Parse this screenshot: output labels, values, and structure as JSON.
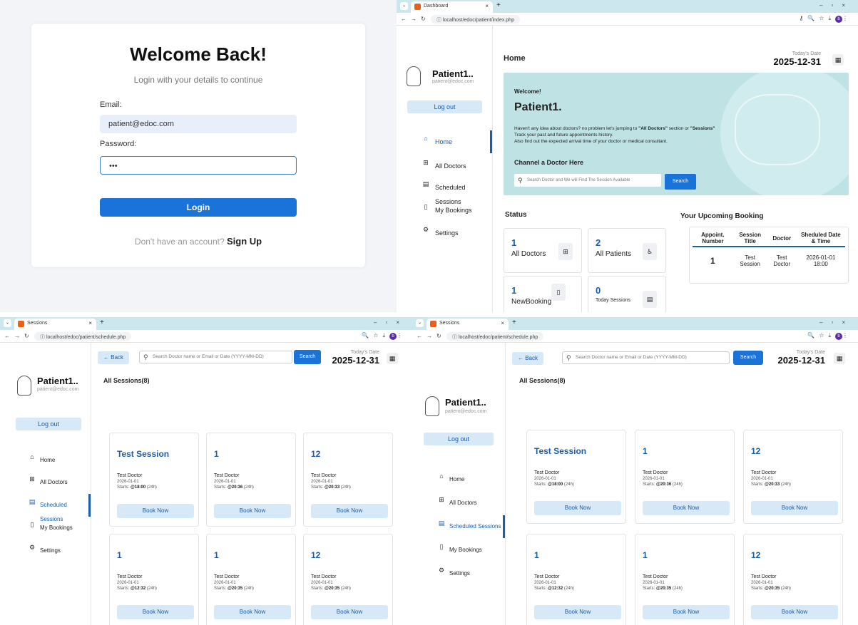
{
  "login": {
    "title": "Welcome Back!",
    "subtitle": "Login with your details to continue",
    "email_label": "Email:",
    "email_value": "patient@edoc.com",
    "password_label": "Password:",
    "password_value": "•••",
    "login_label": "Login",
    "signup_prompt": "Don't have an account?",
    "signup_link": "Sign Up"
  },
  "browser": {
    "dashboard_tab": "Dashboard",
    "sessions_tab": "Sessions",
    "dashboard_url": "localhost/edoc/patient/index.php",
    "sessions_url": "localhost/edoc/patient/schedule.php",
    "profile_initial": "b"
  },
  "user": {
    "name": "Patient1..",
    "email": "patient@edoc.com",
    "logout": "Log out"
  },
  "menu": [
    "Home",
    "All Doctors",
    "Scheduled Sessions",
    "My Bookings",
    "Settings"
  ],
  "date": {
    "label": "Today's Date",
    "value": "2025-12-31"
  },
  "dashboard": {
    "page_title": "Home",
    "welcome": "Welcome!",
    "patient_name": "Patient1.",
    "intro_line1_a": "Haven't any idea about doctors? no problem let's jumping to ",
    "intro_line1_b": "\"All Doctors\"",
    "intro_line1_c": " section or ",
    "intro_line1_d": "\"Sessions\"",
    "intro_line2": "Track your past and future appointments history.",
    "intro_line3": "Also find out the expected arrival time of your doctor or medical consultant.",
    "channel_heading": "Channel a Doctor Here",
    "search_placeholder": "Search Doctor and We will Find The Session Available",
    "search_button": "Search",
    "status_heading": "Status",
    "status": [
      {
        "num": "1",
        "label": "All Doctors"
      },
      {
        "num": "2",
        "label": "All Patients"
      },
      {
        "num": "1",
        "label": "NewBooking"
      },
      {
        "num": "0",
        "label": "Today Sessions"
      }
    ],
    "booking_heading": "Your Upcoming Booking",
    "booking_columns": [
      "Appoint. Number",
      "Session Title",
      "Doctor",
      "Sheduled Date & Time"
    ],
    "booking_row": [
      "1",
      "Test Session",
      "Test Doctor",
      "2026-01-01 18:00"
    ]
  },
  "sessions": {
    "back": "Back",
    "search_placeholder": "Search Doctor name or Email or Date (YYYY-MM-DD)",
    "search_button": "Search",
    "count_label": "All Sessions(8)",
    "book_label": "Book Now",
    "cards": [
      {
        "title": "Test Session",
        "doctor": "Test Doctor",
        "date": "2026-01-01",
        "starts": "@18:00",
        "fmt": "(24h)"
      },
      {
        "title": "1",
        "doctor": "Test Doctor",
        "date": "2026-01-01",
        "starts": "@20:36",
        "fmt": "(24h)"
      },
      {
        "title": "12",
        "doctor": "Test Doctor",
        "date": "2026-01-01",
        "starts": "@20:33",
        "fmt": "(24h)"
      },
      {
        "title": "1",
        "doctor": "Test Doctor",
        "date": "2026-01-01",
        "starts": "@12:32",
        "fmt": "(24h)"
      },
      {
        "title": "1",
        "doctor": "Test Doctor",
        "date": "2026-01-01",
        "starts": "@20:35",
        "fmt": "(24h)"
      },
      {
        "title": "12",
        "doctor": "Test Doctor",
        "date": "2026-01-01",
        "starts": "@20:35",
        "fmt": "(24h)"
      }
    ],
    "starts_prefix": "Starts: "
  }
}
